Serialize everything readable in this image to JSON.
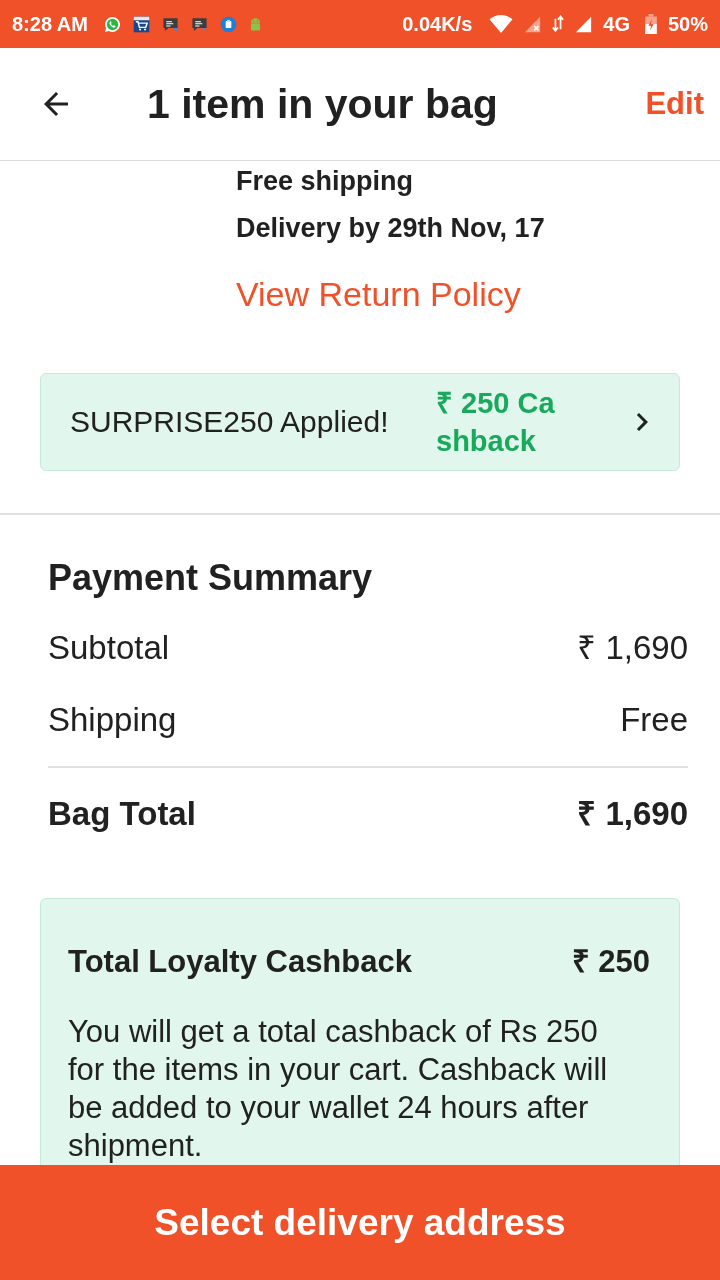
{
  "status_bar": {
    "time": "8:28 AM",
    "speed": "0.04K/s",
    "network": "4G",
    "battery": "50%"
  },
  "header": {
    "title": "1 item in your bag",
    "action": "Edit"
  },
  "item": {
    "shipping": "Free shipping",
    "delivery": "Delivery by 29th Nov, 17",
    "return_policy_link": "View Return Policy"
  },
  "coupon": {
    "label": "SURPRISE250 Applied!",
    "cashback": "₹ 250 Cashback"
  },
  "payment_summary": {
    "title": "Payment Summary",
    "rows": [
      {
        "label": "Subtotal",
        "value": "₹ 1,690"
      },
      {
        "label": "Shipping",
        "value": "Free"
      }
    ],
    "total": {
      "label": "Bag Total",
      "value": "₹ 1,690"
    }
  },
  "loyalty_cashback": {
    "title": "Total Loyalty Cashback",
    "amount": "₹ 250",
    "description": "You will get a total cashback of Rs 250 for the items in your cart. Cashback will be added to your wallet 24 hours after shipment."
  },
  "primary_button": "Select delivery address"
}
